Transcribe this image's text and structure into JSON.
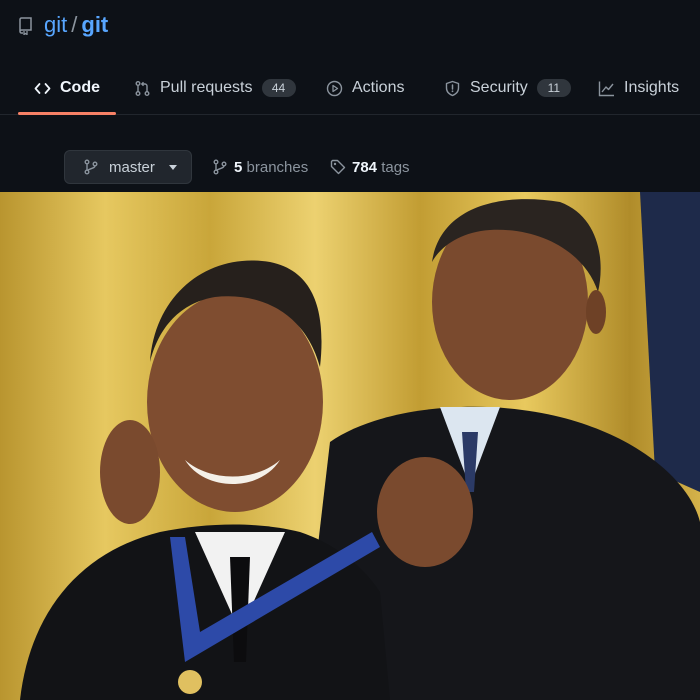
{
  "repo": {
    "owner": "git",
    "separator": "/",
    "name": "git"
  },
  "tabs": [
    {
      "id": "code",
      "label": "Code",
      "icon": "code-icon"
    },
    {
      "id": "pulls",
      "label": "Pull requests",
      "count": "44",
      "icon": "pull-request-icon"
    },
    {
      "id": "actions",
      "label": "Actions",
      "icon": "play-icon"
    },
    {
      "id": "security",
      "label": "Security",
      "count": "11",
      "icon": "shield-icon"
    },
    {
      "id": "insights",
      "label": "Insights",
      "icon": "graph-icon"
    }
  ],
  "branch": {
    "current": "master"
  },
  "stats": {
    "branches_count": "5",
    "branches_label": "branches",
    "tags_count": "784",
    "tags_label": "tags"
  },
  "colors": {
    "accent": "#58a6ff",
    "tab_underline": "#f78166",
    "background": "#0d1117"
  },
  "photo": {
    "subject": "meme photo: man awarding a medal to himself, gold curtain background"
  }
}
